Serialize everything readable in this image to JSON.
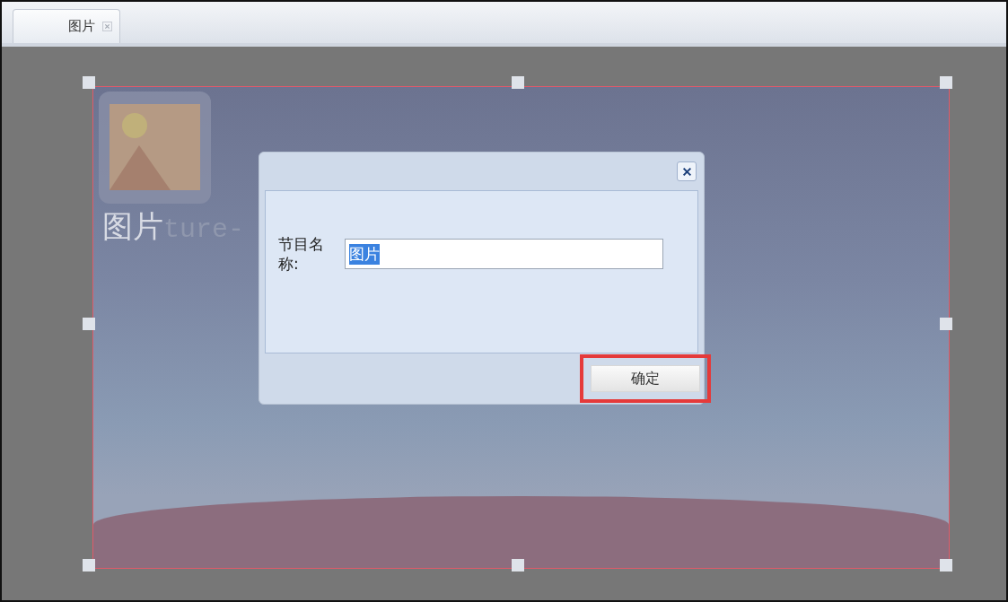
{
  "tabs": [
    {
      "label": "图片",
      "selected": true,
      "closable": true
    }
  ],
  "canvas": {
    "element_label": "图片",
    "element_label_hidden_part": "ture-",
    "selected": true
  },
  "dialog": {
    "field_label": "节目名称:",
    "field_value": "图片",
    "value_selected": true,
    "ok_button": {
      "label": "确定",
      "highlighted": true
    }
  }
}
